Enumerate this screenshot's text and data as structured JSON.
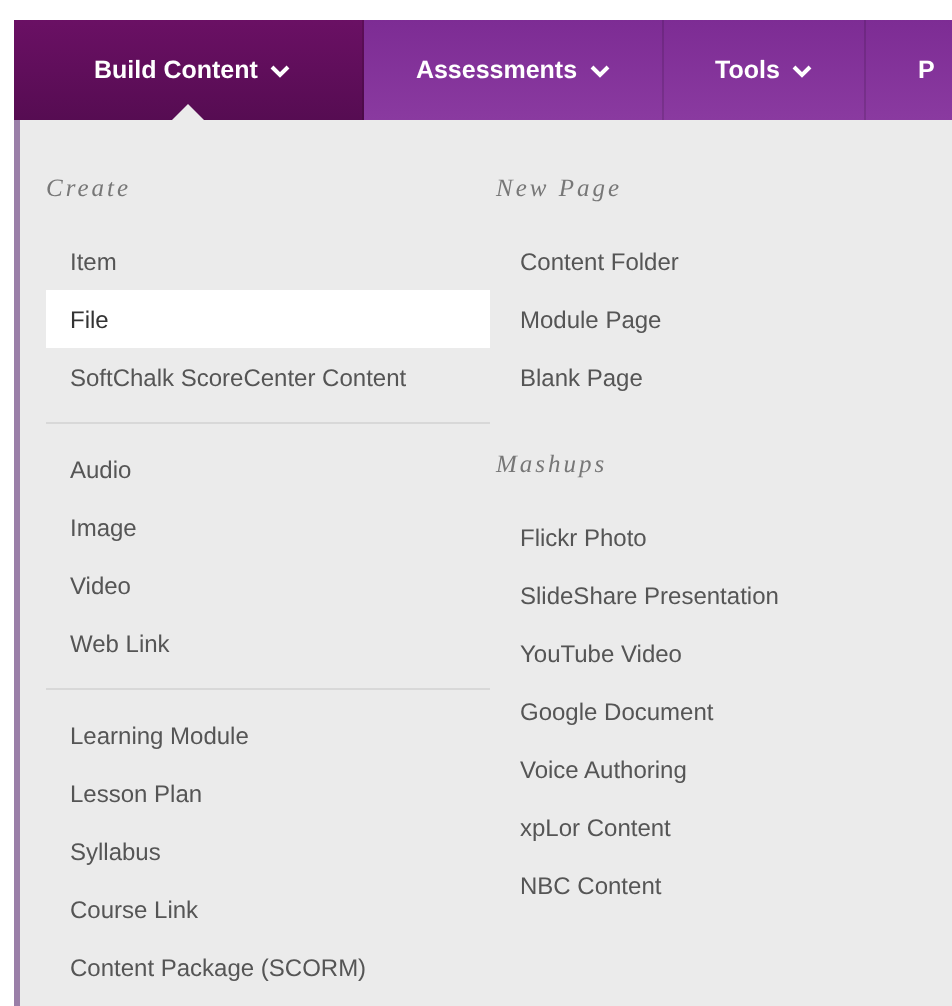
{
  "menu_bar": {
    "tabs": [
      {
        "label": "Build Content",
        "selected": true,
        "caret": true
      },
      {
        "label": "Assessments",
        "selected": false,
        "caret": true
      },
      {
        "label": "Tools",
        "selected": false,
        "caret": true
      },
      {
        "label": "P",
        "selected": false,
        "caret": false
      }
    ]
  },
  "dropdown": {
    "columns": [
      {
        "sections": [
          {
            "heading": "Create",
            "groups": [
              [
                {
                  "label": "Item",
                  "selected": false
                },
                {
                  "label": "File",
                  "selected": true
                },
                {
                  "label": "SoftChalk ScoreCenter Content",
                  "selected": false
                }
              ],
              [
                {
                  "label": "Audio",
                  "selected": false
                },
                {
                  "label": "Image",
                  "selected": false
                },
                {
                  "label": "Video",
                  "selected": false
                },
                {
                  "label": "Web Link",
                  "selected": false
                }
              ],
              [
                {
                  "label": "Learning Module",
                  "selected": false
                },
                {
                  "label": "Lesson Plan",
                  "selected": false
                },
                {
                  "label": "Syllabus",
                  "selected": false
                },
                {
                  "label": "Course Link",
                  "selected": false
                },
                {
                  "label": "Content Package (SCORM)",
                  "selected": false
                }
              ]
            ]
          }
        ]
      },
      {
        "sections": [
          {
            "heading": "New Page",
            "groups": [
              [
                {
                  "label": "Content Folder",
                  "selected": false
                },
                {
                  "label": "Module Page",
                  "selected": false
                },
                {
                  "label": "Blank Page",
                  "selected": false
                }
              ]
            ]
          },
          {
            "heading": "Mashups",
            "groups": [
              [
                {
                  "label": "Flickr Photo",
                  "selected": false
                },
                {
                  "label": "SlideShare Presentation",
                  "selected": false
                },
                {
                  "label": "YouTube Video",
                  "selected": false
                },
                {
                  "label": "Google Document",
                  "selected": false
                },
                {
                  "label": "Voice Authoring",
                  "selected": false
                },
                {
                  "label": "xpLor Content",
                  "selected": false
                },
                {
                  "label": "NBC Content",
                  "selected": false
                }
              ]
            ]
          }
        ]
      }
    ]
  }
}
